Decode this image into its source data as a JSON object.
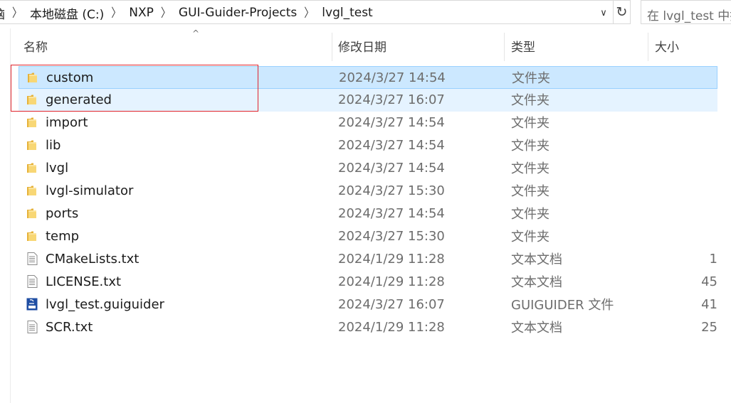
{
  "address": {
    "breadcrumbs": [
      "脑",
      "本地磁盘 (C:)",
      "NXP",
      "GUI-Guider-Projects",
      "lvgl_test"
    ],
    "separator": "〉",
    "dropdown_glyph": "∨",
    "refresh_glyph": "↻"
  },
  "search": {
    "placeholder": "在 lvgl_test 中搜索"
  },
  "columns": {
    "name": "名称",
    "date": "修改日期",
    "type": "类型",
    "size": "大小"
  },
  "sort_indicator": "^",
  "highlight_color": "#e0242c",
  "files": [
    {
      "name": "custom",
      "date": "2024/3/27 14:54",
      "type": "文件夹",
      "size": "",
      "icon": "folder-icon"
    },
    {
      "name": "generated",
      "date": "2024/3/27 16:07",
      "type": "文件夹",
      "size": "",
      "icon": "folder-icon"
    },
    {
      "name": "import",
      "date": "2024/3/27 14:54",
      "type": "文件夹",
      "size": "",
      "icon": "folder-icon"
    },
    {
      "name": "lib",
      "date": "2024/3/27 14:54",
      "type": "文件夹",
      "size": "",
      "icon": "folder-icon"
    },
    {
      "name": "lvgl",
      "date": "2024/3/27 14:54",
      "type": "文件夹",
      "size": "",
      "icon": "folder-icon"
    },
    {
      "name": "lvgl-simulator",
      "date": "2024/3/27 15:30",
      "type": "文件夹",
      "size": "",
      "icon": "folder-icon"
    },
    {
      "name": "ports",
      "date": "2024/3/27 14:54",
      "type": "文件夹",
      "size": "",
      "icon": "folder-icon"
    },
    {
      "name": "temp",
      "date": "2024/3/27 15:30",
      "type": "文件夹",
      "size": "",
      "icon": "folder-icon"
    },
    {
      "name": "CMakeLists.txt",
      "date": "2024/1/29 11:28",
      "type": "文本文档",
      "size": "1",
      "icon": "text-file-icon"
    },
    {
      "name": "LICENSE.txt",
      "date": "2024/1/29 11:28",
      "type": "文本文档",
      "size": "45",
      "icon": "text-file-icon"
    },
    {
      "name": "lvgl_test.guiguider",
      "date": "2024/3/27 16:07",
      "type": "GUIGUIDER 文件",
      "size": "41",
      "icon": "guiguider-file-icon"
    },
    {
      "name": "SCR.txt",
      "date": "2024/1/29 11:28",
      "type": "文本文档",
      "size": "25",
      "icon": "text-file-icon"
    }
  ]
}
